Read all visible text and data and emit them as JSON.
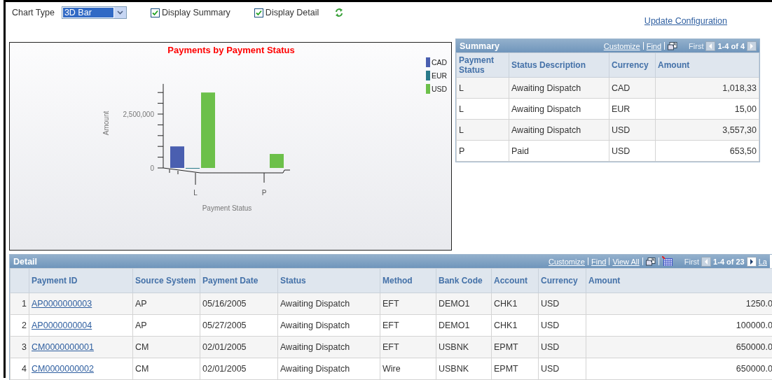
{
  "toolbar": {
    "chart_type": {
      "label": "Chart Type",
      "value": "3D Bar"
    },
    "checkboxes": [
      {
        "label": "Display Summary",
        "checked": true
      },
      {
        "label": "Display Detail",
        "checked": true
      }
    ],
    "update_link": "Update Configuration"
  },
  "chart": {
    "chart_data": {
      "type": "bar",
      "title": "Payments by Payment Status",
      "xlabel": "Payment Status",
      "ylabel": "Amount",
      "categories": [
        "L",
        "P"
      ],
      "series": [
        {
          "name": "CAD",
          "color": "#4a5fb0",
          "values": [
            1000000,
            null
          ]
        },
        {
          "name": "EUR",
          "color": "#2a7a8a",
          "values": [
            0,
            null
          ]
        },
        {
          "name": "USD",
          "color": "#6cc04a",
          "values": [
            3500000,
            650000
          ]
        }
      ],
      "ylim": [
        0,
        3900000
      ],
      "legend": "right",
      "yticks": [
        {
          "value": 0,
          "label": "0"
        },
        {
          "value": 2500000,
          "label": "2,500,000"
        }
      ]
    }
  },
  "summary": {
    "title": "Summary",
    "nav": {
      "links": [
        "Customize",
        "Find"
      ],
      "tools": [
        {
          "kind": "new-window"
        }
      ],
      "first": {
        "label": "First",
        "disabled": true
      },
      "prev_disabled": true,
      "range": "1-4 of 4",
      "next_disabled": true
    },
    "columns": [
      "Payment Status",
      "Status Description",
      "Currency",
      "Amount"
    ],
    "rows": [
      [
        "L",
        "Awaiting Dispatch",
        "CAD",
        "1,018,33"
      ],
      [
        "L",
        "Awaiting Dispatch",
        "EUR",
        "15,00"
      ],
      [
        "L",
        "Awaiting Dispatch",
        "USD",
        "3,557,30"
      ],
      [
        "P",
        "Paid",
        "USD",
        "653,50"
      ]
    ]
  },
  "detail": {
    "title": "Detail",
    "nav": {
      "links": [
        "Customize",
        "Find",
        "View All"
      ],
      "tools": [
        {
          "kind": "new-window"
        },
        {
          "kind": "download"
        }
      ],
      "first": {
        "label": "First",
        "disabled": true
      },
      "prev_disabled": true,
      "range": "1-4 of 23",
      "next_disabled": false,
      "last": "La"
    },
    "columns": [
      "Payment ID",
      "Source System",
      "Payment Date",
      "Status",
      "Method",
      "Bank Code",
      "Account",
      "Currency",
      "Amount"
    ],
    "rows": [
      {
        "number": "1",
        "cells": [
          "AP0000000003",
          "AP",
          "05/16/2005",
          "Awaiting Dispatch",
          "EFT",
          "DEMO1",
          "CHK1",
          "USD",
          "1250.0"
        ]
      },
      {
        "number": "2",
        "cells": [
          "AP0000000004",
          "AP",
          "05/27/2005",
          "Awaiting Dispatch",
          "EFT",
          "DEMO1",
          "CHK1",
          "USD",
          "100000.0"
        ]
      },
      {
        "number": "3",
        "cells": [
          "CM0000000001",
          "CM",
          "02/01/2005",
          "Awaiting Dispatch",
          "EFT",
          "USBNK",
          "EPMT",
          "USD",
          "650000.0"
        ]
      },
      {
        "number": "4",
        "cells": [
          "CM0000000002",
          "CM",
          "02/01/2005",
          "Awaiting Dispatch",
          "Wire",
          "USBNK",
          "EPMT",
          "USD",
          "650000.0"
        ]
      }
    ]
  }
}
